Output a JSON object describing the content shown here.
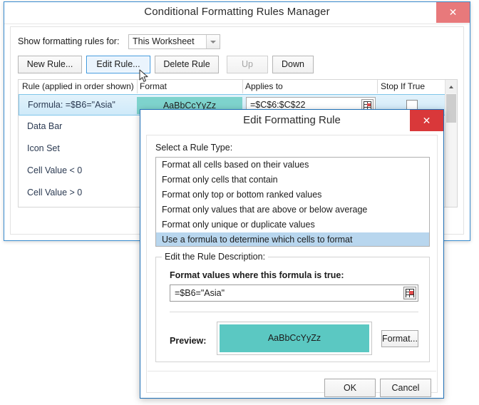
{
  "manager": {
    "title": "Conditional Formatting Rules Manager",
    "close_label": "✕",
    "show_for_label": "Show formatting rules for:",
    "scope_selected": "This Worksheet",
    "scope_options": [
      "This Worksheet"
    ],
    "toolbar": {
      "new_rule": "New Rule...",
      "edit_rule": "Edit Rule...",
      "delete_rule": "Delete Rule",
      "up": "Up",
      "down": "Down"
    },
    "grid": {
      "headers": {
        "rule": "Rule (applied in order shown)",
        "format": "Format",
        "applies_to": "Applies to",
        "stop_if_true": "Stop If True"
      },
      "rows": [
        {
          "rule": "Formula: =$B6=\"Asia\"",
          "format_sample": "AaBbCcYyZz",
          "format_fill": "#7ed3cd",
          "applies_to": "=$C$6:$C$22",
          "stop_if_true": false,
          "selected": true
        },
        {
          "rule": "Data Bar",
          "format_sample": "",
          "format_fill": "",
          "applies_to": "",
          "stop_if_true": false,
          "selected": false
        },
        {
          "rule": "Icon Set",
          "format_sample": "",
          "format_fill": "",
          "applies_to": "",
          "stop_if_true": false,
          "selected": false
        },
        {
          "rule": "Cell Value < 0",
          "format_sample": "",
          "format_fill": "",
          "applies_to": "",
          "stop_if_true": false,
          "selected": false
        },
        {
          "rule": "Cell Value > 0",
          "format_sample": "",
          "format_fill": "",
          "applies_to": "",
          "stop_if_true": false,
          "selected": false
        }
      ]
    }
  },
  "edit_dialog": {
    "title": "Edit Formatting Rule",
    "close_label": "✕",
    "select_rule_type_label": "Select a Rule Type:",
    "rule_types": [
      "Format all cells based on their values",
      "Format only cells that contain",
      "Format only top or bottom ranked values",
      "Format only values that are above or below average",
      "Format only unique or duplicate values",
      "Use a formula to determine which cells to format"
    ],
    "rule_type_selected_index": 5,
    "group_legend": "Edit the Rule Description:",
    "formula_label": "Format values where this formula is true:",
    "formula_value": "=$B6=\"Asia\"",
    "preview_label": "Preview:",
    "preview_sample": "AaBbCcYyZz",
    "preview_fill": "#5bc8c2",
    "format_button": "Format...",
    "ok_button": "OK",
    "cancel_button": "Cancel"
  },
  "colors": {
    "manager_close_red": "#e8797b",
    "dialog_close_red": "#d9383a",
    "window_border_blue": "#1f6fb5",
    "selection_blue": "#b8d6ee",
    "row_selection_blue": "#cfeaf9",
    "teal_fill": "#5bc8c2"
  }
}
